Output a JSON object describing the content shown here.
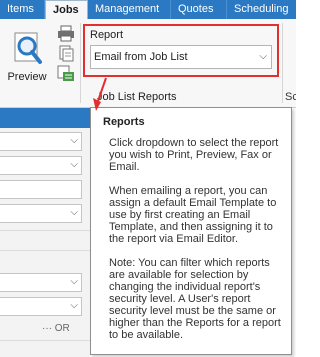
{
  "tabs": [
    {
      "label": "Items",
      "active": false
    },
    {
      "label": "Jobs",
      "active": true
    },
    {
      "label": "Management",
      "active": false
    },
    {
      "label": "Quotes",
      "active": false
    },
    {
      "label": "Scheduling",
      "active": false
    }
  ],
  "ribbon": {
    "preview_label": "Preview",
    "report_group_label": "Report",
    "report_selected": "Email from Job List",
    "group_caption": "Job List Reports",
    "clipped_caption": "Sc"
  },
  "left_panel": {
    "or_label": "··· OR"
  },
  "tooltip": {
    "title": "Reports",
    "paragraphs": [
      "Click dropdown to select the report you wish to Print, Preview, Fax or Email.",
      "When emailing a report, you can assign a default Email Template to use by first creating an Email Template, and then assigning it to the report via Email Editor.",
      "Note: You can filter which reports are available for selection by changing the individual report's security level. A User's report security level must be the same or higher than the Reports for a report to be available."
    ]
  },
  "colors": {
    "ribbon_blue": "#2b79c2",
    "highlight_red": "#e03030"
  }
}
